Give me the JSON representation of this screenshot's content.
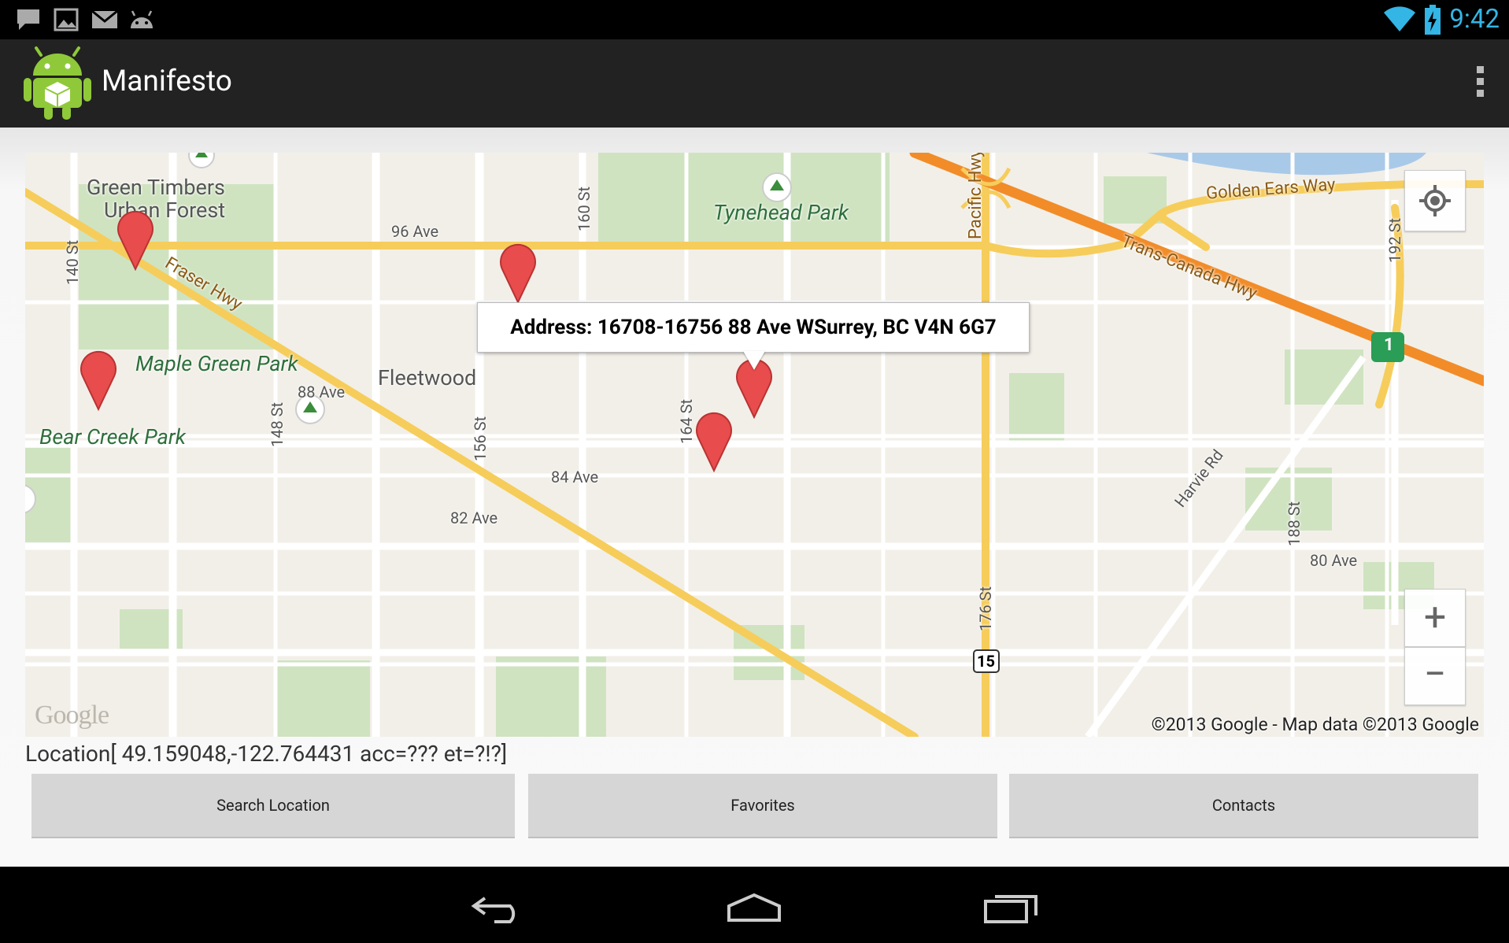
{
  "status_bar": {
    "time": "9:42",
    "left_icons": [
      "chat-icon",
      "image-icon",
      "mail-icon",
      "android-icon"
    ],
    "right_icons": [
      "wifi-icon",
      "battery-charging-icon"
    ],
    "accent_color": "#33b5e5"
  },
  "action_bar": {
    "title": "Manifesto",
    "app_icon": "android-app-icon",
    "overflow_icon": "overflow-menu-icon"
  },
  "map": {
    "info_window": "Address: 16708-16756 88 Ave WSurrey, BC V4N 6G7",
    "copyright": "©2013 Google - Map data ©2013 Google",
    "logo": "Google",
    "labels": {
      "green_timbers_1": "Green Timbers",
      "green_timbers_2": "Urban Forest",
      "tynehead": "Tynehead Park",
      "golden_ears": "Golden Ears Way",
      "trans_canada": "Trans-Canada Hwy",
      "maple_green": "Maple Green Park",
      "fleetwood": "Fleetwood",
      "bear_creek": "Bear Creek Park",
      "fraser_hwy": "Fraser Hwy",
      "pacific_hwy": "Pacific Hwy",
      "harvie_rd": "Harvie Rd",
      "ave_96": "96 Ave",
      "ave_88": "88 Ave",
      "ave_84": "84 Ave",
      "ave_82": "82 Ave",
      "ave_80": "80 Ave",
      "st_140": "140 St",
      "st_148": "148 St",
      "st_156": "156 St",
      "st_160": "160 St",
      "st_164": "164 St",
      "st_176": "176 St",
      "st_188": "188 St",
      "st_192": "192 St",
      "shield_1": "1",
      "shield_15": "15"
    },
    "controls": {
      "my_location_icon": "crosshair-icon",
      "zoom_in": "+",
      "zoom_out": "−"
    },
    "marker_color": "#e84c4c"
  },
  "location_text": "Location[ 49.159048,-122.764431 acc=??? et=?!?]",
  "buttons": {
    "search": "Search Location",
    "favorites": "Favorites",
    "contacts": "Contacts"
  },
  "nav_bar": {
    "icons": [
      "back-icon",
      "home-icon",
      "recents-icon"
    ]
  }
}
